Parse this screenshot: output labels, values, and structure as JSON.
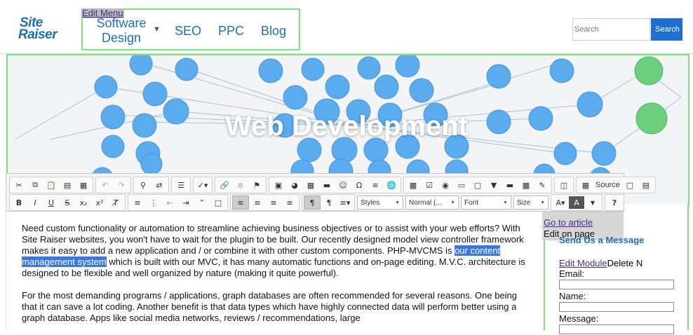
{
  "header": {
    "logo_line1": "Site",
    "logo_line2": "Raiser",
    "edit_menu": "Edit Menu",
    "nav": {
      "software_design": "Software Design",
      "seo": "SEO",
      "ppc": "PPC",
      "blog": "Blog"
    },
    "search_placeholder": "Search",
    "search_button": "Search"
  },
  "hero": {
    "title": "Web Development"
  },
  "toolbar": {
    "source_label": "Source",
    "styles_label": "Styles",
    "format_label": "Normal (...",
    "font_label": "Font",
    "size_label": "Size"
  },
  "content": {
    "p1_before": "Need custom functionality or automation to streamline achieving business objectives or to assist with your web efforts? With Site Raiser websites, you won't have to wait for the plugin to be built. Our recently designed model view controller framework makes it easy to add a new application and / or combine it with other custom components. PHP-MVCMS is ",
    "p1_highlight": "our content management system",
    "p1_after": " which is built with our MVC, it has many automatic functions and on-page editing.  M.V.C. architecture is designed to be flexible and well organized by nature (making it quite powerful).",
    "p2": "For the most demanding programs / applications, graph databases are often recommended for several reasons. One being that it can save a lot coding. Another benefit is that data types which have highly connected data will perform better using a graph database. Apps like social media networks, reviews / recommendations, large"
  },
  "sidebar": {
    "go_to_article": "Go to article",
    "edit_on_page": "Edit on page",
    "send_message": "Send Us a Message",
    "edit_module": "Edit Module",
    "delete": "Delete N",
    "email_label": "Email:",
    "name_label": "Name:",
    "message_label": "Message:"
  },
  "colors": {
    "brand_blue": "#1f6fb5",
    "button_blue": "#1f6fd0",
    "edit_outline_green": "#7ee07e",
    "highlight_blue": "#3b78d8",
    "node_blue": "#5aacee",
    "node_green": "#6ccf7e"
  }
}
